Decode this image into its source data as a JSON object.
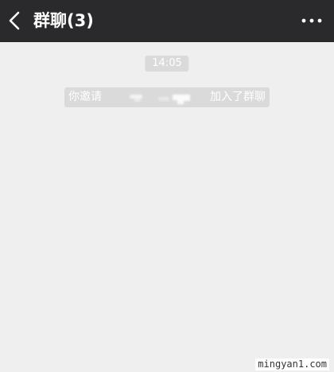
{
  "header": {
    "title": "群聊(3)",
    "back_icon": "chevron-left-icon",
    "more_icon": "more-dots-icon"
  },
  "chat": {
    "timestamp": "14:05",
    "system_message": {
      "prefix": "你邀请",
      "suffix": "加入了群聊"
    }
  },
  "watermark": "mingyan1.com",
  "colors": {
    "navbar": "#2a2a2c",
    "background": "#efefef",
    "pill": "#dadada",
    "text_light": "#ffffff"
  }
}
